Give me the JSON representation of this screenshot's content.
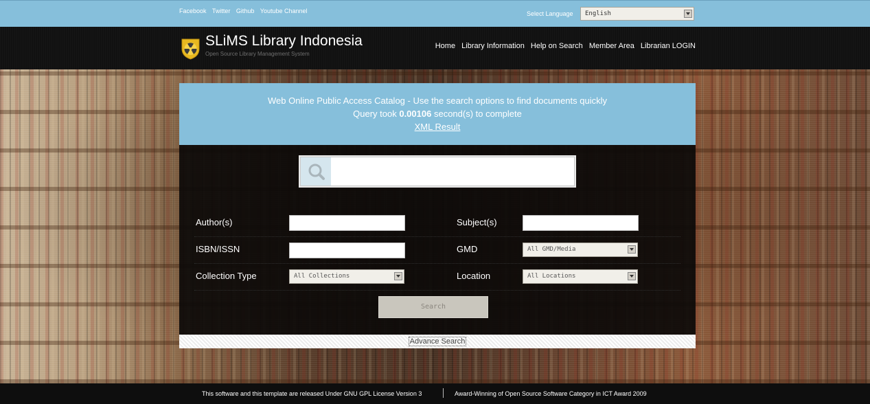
{
  "topbar": {
    "social": [
      "Facebook",
      "Twitter",
      "Github",
      "Youtube Channel"
    ],
    "language_label": "Select Language",
    "language_value": "English"
  },
  "header": {
    "title": "SLiMS Library Indonesia",
    "subtitle": "Open Source Library Management System",
    "nav": [
      "Home",
      "Library Information",
      "Help on Search",
      "Member Area",
      "Librarian LOGIN"
    ]
  },
  "info": {
    "line1": "Web Online Public Access Catalog - Use the search options to find documents quickly",
    "query_prefix": "Query took",
    "query_time": "0.00106",
    "query_suffix": "second(s) to complete",
    "xml_link": "XML Result"
  },
  "search": {
    "keyword_value": ""
  },
  "fields": {
    "author_label": "Author(s)",
    "subject_label": "Subject(s)",
    "isbn_label": "ISBN/ISSN",
    "gmd_label": "GMD",
    "gmd_value": "All GMD/Media",
    "collection_label": "Collection Type",
    "collection_value": "All Collections",
    "location_label": "Location",
    "location_value": "All Locations",
    "search_button": "Search"
  },
  "advanced": {
    "link": "Advance Search"
  },
  "footer": {
    "left": "This software and this template are released Under GNU GPL License Version 3",
    "right": "Award-Winning of Open Source Software Category in ICT Award 2009"
  },
  "colors": {
    "accent_blue": "#86bfdb",
    "header_dark": "#111111",
    "logo_yellow": "#e8b820"
  }
}
